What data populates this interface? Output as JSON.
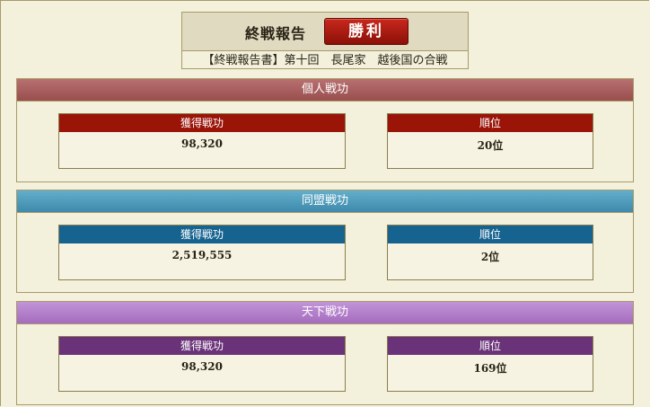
{
  "header": {
    "title": "終戦報告",
    "result_label": "勝利",
    "subtitle": "【終戦報告書】第十回　長尾家　越後国の合戦"
  },
  "sections": [
    {
      "title": "個人戦功",
      "colors": {
        "head": "#a45a5a",
        "card_head": "#9a1408"
      },
      "merit_label": "獲得戦功",
      "merit_value": "98,320",
      "rank_label": "順位",
      "rank_value": "20位"
    },
    {
      "title": "同盟戦功",
      "colors": {
        "head": "#4d9cbd",
        "card_head": "#17638f"
      },
      "merit_label": "獲得戦功",
      "merit_value": "2,519,555",
      "rank_label": "順位",
      "rank_value": "2位"
    },
    {
      "title": "天下戦功",
      "colors": {
        "head": "#b07fc9",
        "card_head": "#6a3278"
      },
      "merit_label": "獲得戦功",
      "merit_value": "98,320",
      "rank_label": "順位",
      "rank_value": "169位"
    }
  ]
}
